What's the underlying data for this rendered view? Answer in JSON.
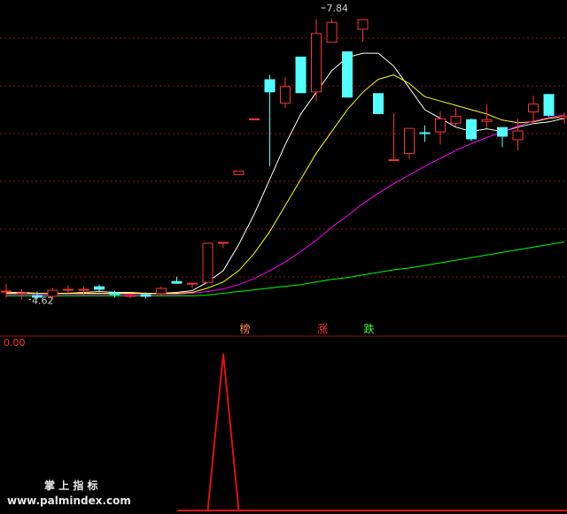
{
  "chart_data": [
    {
      "type": "candlestick",
      "panel": "main",
      "title": "",
      "ylim": [
        4.4,
        8.0
      ],
      "price_labels": {
        "high": "7.84",
        "low": "4.62"
      },
      "colors": {
        "up": "#ff3232",
        "down": "#54ffff",
        "ma5": "#ffffff",
        "ma10": "#ffff00",
        "ma20": "#ff00ff",
        "ma60": "#00ff00",
        "grid": "#8a1212"
      },
      "candles": [
        {
          "o": 4.72,
          "h": 4.8,
          "l": 4.64,
          "c": 4.72
        },
        {
          "o": 4.7,
          "h": 4.74,
          "l": 4.62,
          "c": 4.7
        },
        {
          "o": 4.67,
          "h": 4.71,
          "l": 4.62,
          "c": 4.64
        },
        {
          "o": 4.65,
          "h": 4.75,
          "l": 4.63,
          "c": 4.73
        },
        {
          "o": 4.74,
          "h": 4.78,
          "l": 4.7,
          "c": 4.74
        },
        {
          "o": 4.72,
          "h": 4.77,
          "l": 4.66,
          "c": 4.74
        },
        {
          "o": 4.77,
          "h": 4.79,
          "l": 4.7,
          "c": 4.73
        },
        {
          "o": 4.7,
          "h": 4.72,
          "l": 4.64,
          "c": 4.67
        },
        {
          "o": 4.67,
          "h": 4.69,
          "l": 4.63,
          "c": 4.67
        },
        {
          "o": 4.68,
          "h": 4.7,
          "l": 4.63,
          "c": 4.65
        },
        {
          "o": 4.68,
          "h": 4.77,
          "l": 4.66,
          "c": 4.75
        },
        {
          "o": 4.83,
          "h": 4.88,
          "l": 4.8,
          "c": 4.8
        },
        {
          "o": 4.79,
          "h": 4.81,
          "l": 4.75,
          "c": 4.81
        },
        {
          "o": 4.81,
          "h": 5.27,
          "l": 4.81,
          "c": 5.27
        },
        {
          "o": 5.28,
          "h": 5.28,
          "l": 5.21,
          "c": 5.28
        },
        {
          "o": 6.05,
          "h": 6.1,
          "l": 6.05,
          "c": 6.1
        },
        {
          "o": 6.7,
          "h": 6.7,
          "l": 6.7,
          "c": 6.7
        },
        {
          "o": 7.15,
          "h": 7.2,
          "l": 6.15,
          "c": 7.0
        },
        {
          "o": 6.87,
          "h": 7.17,
          "l": 6.82,
          "c": 7.07
        },
        {
          "o": 7.41,
          "h": 7.41,
          "l": 6.99,
          "c": 6.99
        },
        {
          "o": 7.0,
          "h": 7.84,
          "l": 6.9,
          "c": 7.68
        },
        {
          "o": 7.57,
          "h": 7.84,
          "l": 7.57,
          "c": 7.81
        },
        {
          "o": 7.47,
          "h": 7.47,
          "l": 6.94,
          "c": 6.94
        },
        {
          "o": 7.72,
          "h": 7.84,
          "l": 7.58,
          "c": 7.84
        },
        {
          "o": 6.99,
          "h": 6.99,
          "l": 6.75,
          "c": 6.75
        },
        {
          "o": 6.23,
          "h": 6.76,
          "l": 6.23,
          "c": 6.23
        },
        {
          "o": 6.29,
          "h": 6.58,
          "l": 6.23,
          "c": 6.59
        },
        {
          "o": 6.54,
          "h": 6.62,
          "l": 6.43,
          "c": 6.52
        },
        {
          "o": 6.54,
          "h": 6.78,
          "l": 6.4,
          "c": 6.7
        },
        {
          "o": 6.64,
          "h": 6.82,
          "l": 6.61,
          "c": 6.73
        },
        {
          "o": 6.69,
          "h": 6.7,
          "l": 6.44,
          "c": 6.46
        },
        {
          "o": 6.66,
          "h": 6.86,
          "l": 6.59,
          "c": 6.69
        },
        {
          "o": 6.6,
          "h": 6.6,
          "l": 6.37,
          "c": 6.49
        },
        {
          "o": 6.45,
          "h": 6.7,
          "l": 6.33,
          "c": 6.56
        },
        {
          "o": 6.77,
          "h": 6.96,
          "l": 6.64,
          "c": 6.87
        },
        {
          "o": 6.98,
          "h": 6.98,
          "l": 6.72,
          "c": 6.73
        },
        {
          "o": 6.7,
          "h": 6.77,
          "l": 6.64,
          "c": 6.73
        }
      ],
      "ma": {
        "ma5": [
          4.7,
          4.7,
          4.69,
          4.69,
          4.69,
          4.7,
          4.71,
          4.7,
          4.7,
          4.69,
          4.69,
          4.7,
          4.72,
          4.82,
          4.95,
          5.25,
          5.6,
          6.0,
          6.4,
          6.75,
          7.0,
          7.25,
          7.4,
          7.45,
          7.45,
          7.3,
          7.05,
          6.8,
          6.7,
          6.6,
          6.55,
          6.58,
          6.55,
          6.6,
          6.64,
          6.66,
          6.7
        ],
        "ma10": [
          4.69,
          4.69,
          4.69,
          4.69,
          4.69,
          4.69,
          4.69,
          4.69,
          4.69,
          4.69,
          4.69,
          4.69,
          4.7,
          4.75,
          4.82,
          4.95,
          5.15,
          5.4,
          5.7,
          6.0,
          6.3,
          6.55,
          6.8,
          7.0,
          7.15,
          7.2,
          7.1,
          6.95,
          6.9,
          6.85,
          6.8,
          6.75,
          6.68,
          6.65,
          6.66,
          6.7,
          6.72
        ],
        "ma20": [
          4.68,
          4.68,
          4.68,
          4.68,
          4.68,
          4.68,
          4.68,
          4.68,
          4.68,
          4.68,
          4.68,
          4.68,
          4.69,
          4.71,
          4.74,
          4.79,
          4.86,
          4.95,
          5.05,
          5.17,
          5.3,
          5.45,
          5.58,
          5.72,
          5.84,
          5.95,
          6.05,
          6.15,
          6.24,
          6.33,
          6.41,
          6.48,
          6.55,
          6.61,
          6.67,
          6.71,
          6.74
        ],
        "ma60": [
          4.66,
          4.66,
          4.66,
          4.66,
          4.66,
          4.66,
          4.66,
          4.66,
          4.66,
          4.66,
          4.66,
          4.66,
          4.66,
          4.67,
          4.69,
          4.71,
          4.73,
          4.75,
          4.77,
          4.79,
          4.82,
          4.85,
          4.87,
          4.9,
          4.93,
          4.96,
          4.98,
          5.01,
          5.04,
          5.07,
          5.1,
          5.13,
          5.16,
          5.19,
          5.22,
          5.25,
          5.28
        ]
      },
      "markers": [
        {
          "index": 15,
          "text": "榜",
          "color": "#ff8a3c"
        },
        {
          "index": 20,
          "text": "涨",
          "color": "#ff3232"
        },
        {
          "index": 23,
          "text": "跌",
          "color": "#33ff33"
        }
      ]
    },
    {
      "type": "line",
      "panel": "indicator",
      "value_label": "0.00",
      "color": "#e01010",
      "ylim": [
        0,
        1
      ],
      "values": [
        0,
        0,
        0,
        0,
        0,
        0,
        0,
        0,
        0,
        0,
        0,
        0,
        0,
        0,
        1,
        0,
        0,
        0,
        0,
        0,
        0,
        0,
        0,
        0,
        0,
        0,
        0,
        0,
        0,
        0,
        0,
        0,
        0,
        0,
        0,
        0,
        0
      ]
    }
  ],
  "watermark": {
    "title": "掌 上 指 标",
    "url": "www.palmindex.com"
  }
}
